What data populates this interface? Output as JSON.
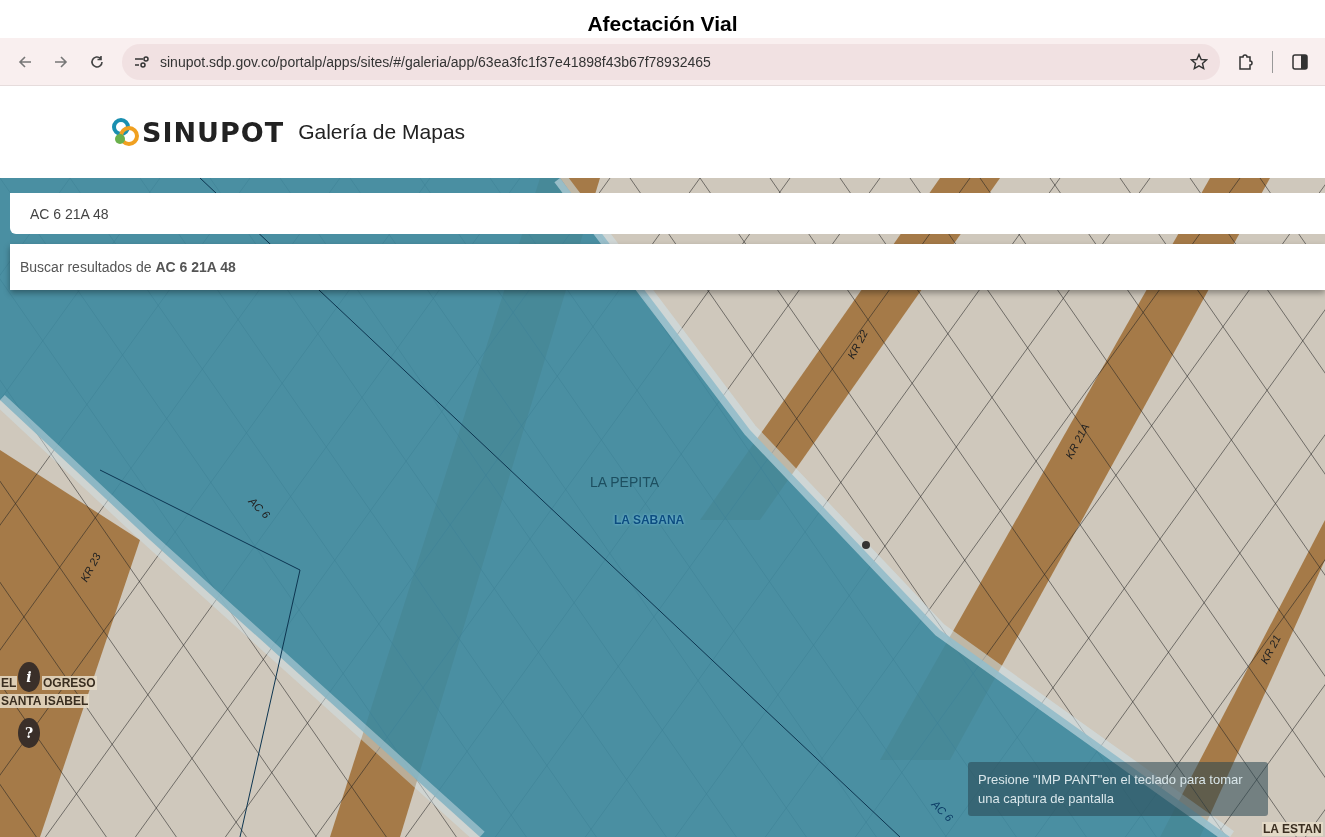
{
  "page_title": "Afectación Vial",
  "browser": {
    "url": "sinupot.sdp.gov.co/portalp/apps/sites/#/galeria/app/63ea3fc1f37e41898f43b67f78932465"
  },
  "header": {
    "logo": "SINUPOT",
    "title": "Galería de Mapas"
  },
  "search": {
    "value": "AC 6 21A 48",
    "suggestion": "Buscar resultados de **AC 6 21A 48**"
  },
  "map_labels": [
    {
      "text": "KR 22",
      "kind": "street"
    },
    {
      "text": "KR 21A",
      "kind": "street"
    },
    {
      "text": "AC 6",
      "kind": "street"
    },
    {
      "text": "KR 23",
      "kind": "street"
    },
    {
      "text": "KR 21",
      "kind": "street"
    },
    {
      "text": "AC 6",
      "kind": "street-blue"
    },
    {
      "text": "LA PEPITA",
      "kind": "area"
    },
    {
      "text": "LA SABANA",
      "kind": "area-blue"
    },
    {
      "text": "EL",
      "kind": "area-dark"
    },
    {
      "text": "OGRESO",
      "kind": "area-dark"
    },
    {
      "text": "SANTA ISABEL",
      "kind": "area-dark"
    },
    {
      "text": "LA ESTAN",
      "kind": "area-dark"
    }
  ],
  "map_buttons": [
    {
      "kind": "info",
      "label": "i"
    },
    {
      "kind": "help",
      "label": "?"
    }
  ],
  "tooltip": "Presione \"IMP PANT\"en el teclado para tomar una captura de pantalla"
}
